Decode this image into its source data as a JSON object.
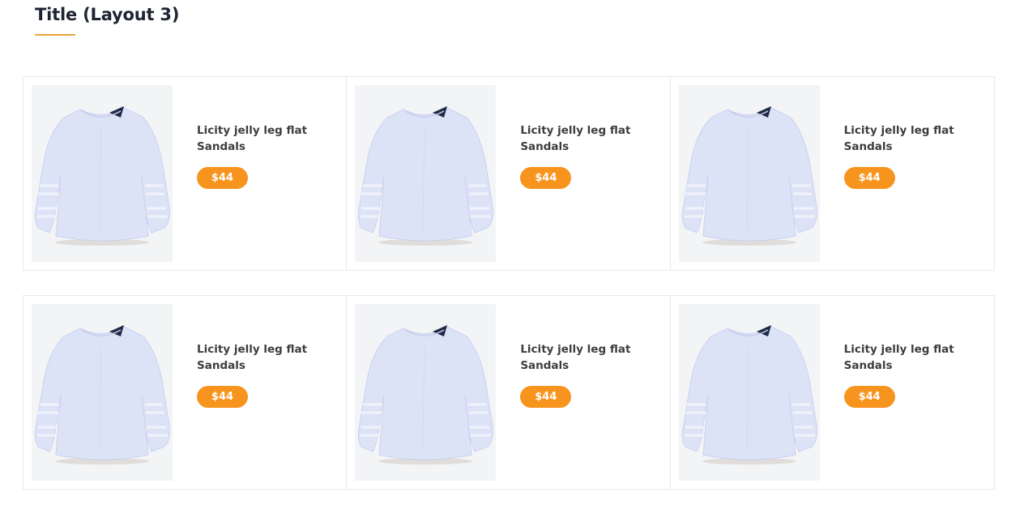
{
  "section": {
    "title": "Title (Layout 3)"
  },
  "colors": {
    "accent": "#f7941e",
    "underline": "#e9a73b",
    "image_bg": "#f3f4f6",
    "shirt": "#dde3f7",
    "collar": "#1f2a44"
  },
  "products": [
    {
      "name": "Licity jelly leg flat Sandals",
      "price": "$44",
      "image": "blouse-image"
    },
    {
      "name": "Licity jelly leg flat Sandals",
      "price": "$44",
      "image": "blouse-image"
    },
    {
      "name": "Licity jelly leg flat Sandals",
      "price": "$44",
      "image": "blouse-image"
    },
    {
      "name": "Licity jelly leg flat Sandals",
      "price": "$44",
      "image": "blouse-image"
    },
    {
      "name": "Licity jelly leg flat Sandals",
      "price": "$44",
      "image": "blouse-image"
    },
    {
      "name": "Licity jelly leg flat Sandals",
      "price": "$44",
      "image": "blouse-image"
    }
  ]
}
